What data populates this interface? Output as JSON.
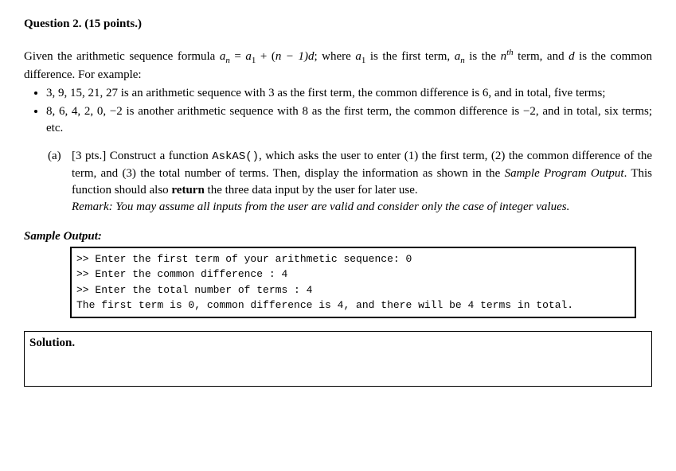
{
  "question": {
    "number": "Question 2.",
    "points": "(15 points.)"
  },
  "intro": {
    "text_pre": "Given the arithmetic sequence formula ",
    "formula_an": "a",
    "formula_n_sub": "n",
    "formula_eq": " = ",
    "formula_a1": "a",
    "formula_1_sub": "1",
    "formula_plus": " + (",
    "formula_n": "n",
    "formula_minus1d": " − 1)d",
    "text_where": "; where ",
    "text_a1_desc": " is the first term, ",
    "text_an_desc": " is the ",
    "nth_n": "n",
    "nth_th": "th",
    "text_post": " term, and ",
    "d_var": "d",
    "text_end": " is the common difference. For example:"
  },
  "bullet1": "3, 9, 15, 21, 27 is an arithmetic sequence with 3 as the first term, the common difference is 6, and in total, five terms;",
  "bullet2": "8, 6, 4, 2, 0, −2 is another arithmetic sequence with 8 as the first term, the common difference is −2, and in total, six terms; etc.",
  "part_a": {
    "label": "(a)",
    "pts": "[3 pts.]",
    "text1": " Construct a function ",
    "fn": "AskAS()",
    "text2": ",  which asks the user to enter (1) the first term, (2) the common difference of the term, and (3) the total number of terms. Then, display the information as shown in the ",
    "sample_ref": "Sample Program Output",
    "text3": ". This function should also ",
    "return_word": "return",
    "text4": " the three data input by the user for later use.",
    "remark": "Remark: You may assume all inputs from the user are valid and consider only the case of integer values."
  },
  "sample_output_title": "Sample Output:",
  "code": {
    "line1": ">> Enter the first term of your arithmetic sequence: 0",
    "line2": ">> Enter the common difference : 4",
    "line3": ">> Enter the total number of terms : 4",
    "line4": "The first term is 0, common difference is 4, and there will be 4 terms in total."
  },
  "solution_label": "Solution."
}
